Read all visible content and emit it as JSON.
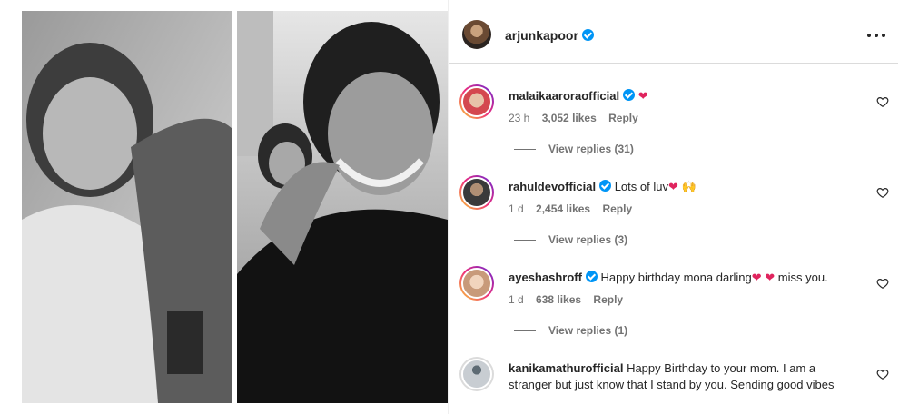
{
  "post": {
    "author": "arjunkapoor",
    "author_verified": true
  },
  "comments": [
    {
      "user": "malaikaaroraofficial",
      "verified": true,
      "text": "",
      "emoji": "❤",
      "time": "23 h",
      "likes": "3,052 likes",
      "reply": "Reply",
      "view_replies": "View replies (31)",
      "avatar_color": "#d4484f"
    },
    {
      "user": "rahuldevofficial",
      "verified": true,
      "text": "Lots of luv",
      "emoji": "❤ 🙌",
      "time": "1 d",
      "likes": "2,454 likes",
      "reply": "Reply",
      "view_replies": "View replies (3)",
      "avatar_color": "#3a3a3a"
    },
    {
      "user": "ayeshashroff",
      "verified": true,
      "text": "Happy birthday mona darling",
      "emoji": "❤ ❤",
      "text_after": "miss you.",
      "time": "1 d",
      "likes": "638 likes",
      "reply": "Reply",
      "view_replies": "View replies (1)",
      "avatar_color": "#c89a7a"
    },
    {
      "user": "kanikamathurofficial",
      "verified": false,
      "text": "Happy Birthday to your mom. I am a stranger but just know that I stand by you. Sending good vibes",
      "avatar_color": "#8a8f96"
    }
  ],
  "colors": {
    "accent_blue": "#0095f6",
    "secondary_text": "#737373",
    "heart_red": "#e0245e"
  },
  "icons": {
    "more": "more-horizontal-icon",
    "like": "heart-outline-icon",
    "verified": "verified-badge-icon"
  }
}
